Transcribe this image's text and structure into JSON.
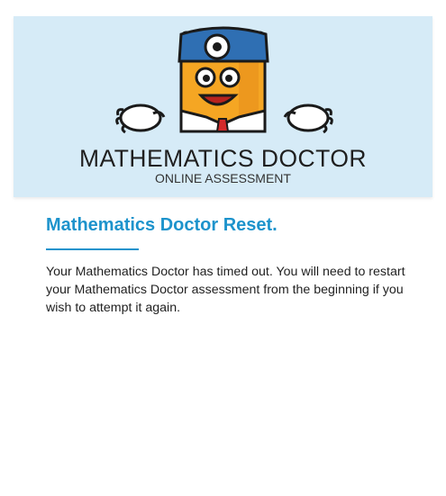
{
  "header": {
    "brand_title": "MATHEMATICS DOCTOR",
    "brand_subtitle": "ONLINE ASSESSMENT",
    "colors": {
      "banner": "#d6ebf7",
      "mascot_body": "#f5a623",
      "mascot_cap": "#2f6fb3"
    }
  },
  "main": {
    "heading": "Mathematics Doctor Reset.",
    "message": "Your Mathematics Doctor has timed out. You will need to restart your Mathematics Doctor assessment from the beginning if you wish to attempt it again.",
    "accent_color": "#1d93cc"
  }
}
